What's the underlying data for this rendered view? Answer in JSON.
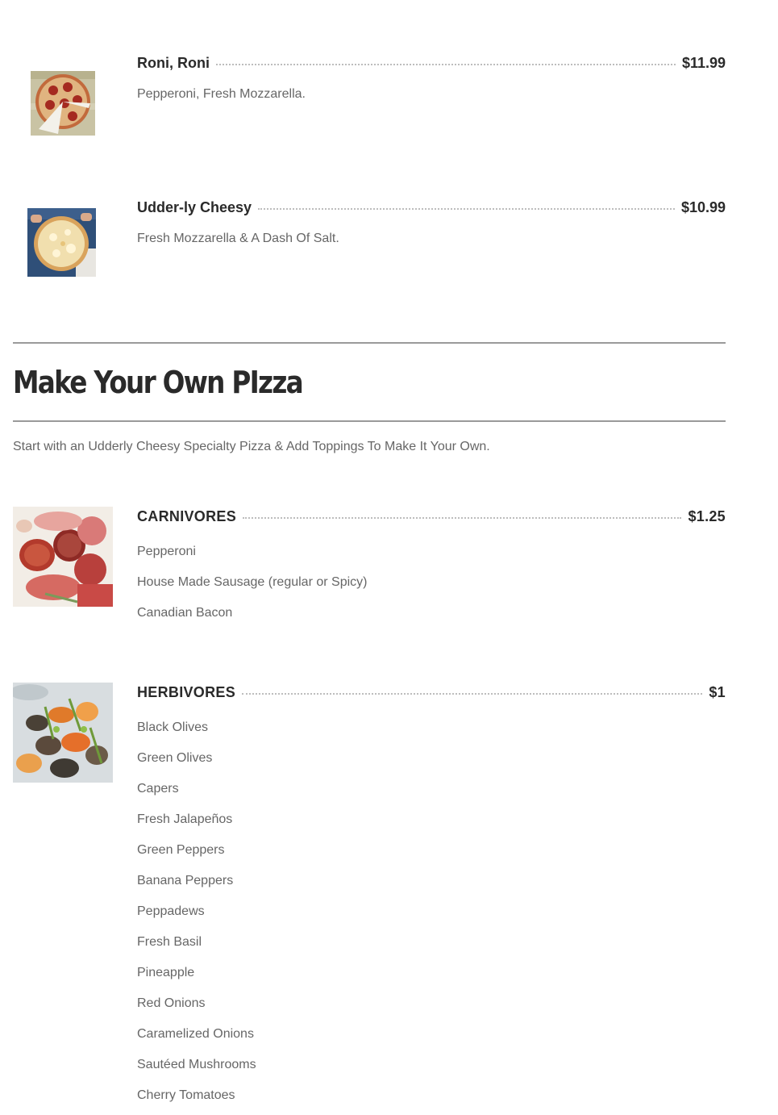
{
  "specialty_items": [
    {
      "name": "Roni, Roni",
      "price": "$11.99",
      "description": "Pepperoni, Fresh Mozzarella.",
      "image": "pepperoni-pizza-photo"
    },
    {
      "name": "Udder-ly Cheesy",
      "price": "$10.99",
      "description": "Fresh Mozzarella & A Dash Of Salt.",
      "image": "cheese-pizza-photo"
    }
  ],
  "section": {
    "title": "Make Your Own PIzza",
    "subtitle": "Start with an Udderly Cheesy Specialty Pizza & Add Toppings To Make It Your Own."
  },
  "topping_groups": [
    {
      "name": "CARNIVORES",
      "price": "$1.25",
      "image": "cured-meats-photo",
      "items": [
        "Pepperoni",
        "House Made Sausage (regular or Spicy)",
        "Canadian Bacon"
      ]
    },
    {
      "name": "HERBIVORES",
      "price": "$1",
      "image": "roasted-vegetables-photo",
      "items": [
        "Black Olives",
        "Green Olives",
        "Capers",
        "Fresh Jalapeños",
        "Green Peppers",
        "Banana Peppers",
        "Peppadews",
        "Fresh Basil",
        "Pineapple",
        "Red Onions",
        "Caramelized Onions",
        "Sautéed Mushrooms",
        "Cherry Tomatoes"
      ]
    }
  ],
  "colors": {
    "heading": "#2a2a2a",
    "text": "#666666",
    "rule": "#9a9a9a",
    "leader": "#bdbdbd"
  }
}
